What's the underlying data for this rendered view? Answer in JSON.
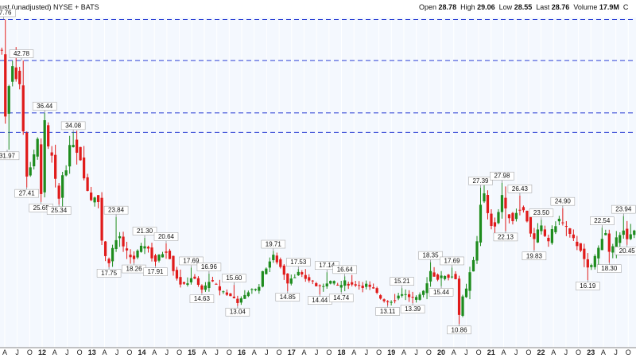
{
  "header": {
    "title": "ust (unadjusted)  NYSE + BATS",
    "ohlc": [
      {
        "label": "Open",
        "value": "28.78"
      },
      {
        "label": "High",
        "value": "29.06"
      },
      {
        "label": "Low",
        "value": "28.55"
      },
      {
        "label": "Last",
        "value": "28.76"
      },
      {
        "label": "Volume",
        "value": "17.9M"
      }
    ],
    "trailing": "C"
  },
  "colors": {
    "up": "#1e8c1e",
    "down": "#e01b1b",
    "resistance_line": "#2b3fd4",
    "plot_bg": "#f4f8fe",
    "grid": "#ffffff"
  },
  "chart_data": {
    "type": "candlestick",
    "x_axis_labels": [
      "A",
      "J",
      "O",
      "12",
      "A",
      "J",
      "O",
      "13",
      "A",
      "J",
      "O",
      "14",
      "A",
      "J",
      "O",
      "15",
      "A",
      "J",
      "O",
      "16",
      "A",
      "J",
      "O",
      "17",
      "A",
      "J",
      "O",
      "18",
      "A",
      "J",
      "O",
      "19",
      "A",
      "J",
      "O",
      "20",
      "A",
      "J",
      "O",
      "21",
      "A",
      "J",
      "O",
      "22",
      "A",
      "J",
      "O",
      "23",
      "A",
      "J",
      "O"
    ],
    "x_axis_label_years": [
      "12",
      "13",
      "14",
      "15",
      "16",
      "17",
      "18",
      "19",
      "20",
      "21",
      "22",
      "23"
    ],
    "ylim": [
      8,
      48
    ],
    "resistance_levels": [
      47.76,
      42.78,
      36.44,
      34.08
    ],
    "price_labels": [
      "47.76",
      "42.78",
      "31.97",
      "27.41",
      "36.44",
      "25.65",
      "25.34",
      "34.08",
      "23.84",
      "17.75",
      "18.26",
      "21.30",
      "17.91",
      "20.64",
      "17.69",
      "16.96",
      "14.63",
      "15.60",
      "13.04",
      "19.71",
      "14.85",
      "17.53",
      "14.44",
      "17.14",
      "14.74",
      "16.64",
      "15.21",
      "13.11",
      "13.39",
      "18.35",
      "15.44",
      "17.69",
      "10.86",
      "27.39",
      "27.98",
      "22.13",
      "26.43",
      "23.50",
      "19.83",
      "24.90",
      "16.19",
      "22.54",
      "18.30",
      "23.94",
      "20.45"
    ],
    "price_label_marks": [
      {
        "text": "47.76",
        "type": "high",
        "x": 0.5
      },
      {
        "text": "42.78",
        "type": "high",
        "x": 5.5
      },
      {
        "text": "31.97",
        "type": "low",
        "x": 1.5
      },
      {
        "text": "27.41",
        "type": "low",
        "x": 7.0
      },
      {
        "text": "36.44",
        "type": "high",
        "x": 12.0
      },
      {
        "text": "25.65",
        "type": "low",
        "x": 11.0
      },
      {
        "text": "25.34",
        "type": "low",
        "x": 16.0
      },
      {
        "text": "34.08",
        "type": "high",
        "x": 20.0
      },
      {
        "text": "23.84",
        "type": "high",
        "x": 32.0
      },
      {
        "text": "17.75",
        "type": "low",
        "x": 30.0
      },
      {
        "text": "18.26",
        "type": "low",
        "x": 37.0
      },
      {
        "text": "21.30",
        "type": "high",
        "x": 40.0
      },
      {
        "text": "17.91",
        "type": "low",
        "x": 43.0
      },
      {
        "text": "20.64",
        "type": "high",
        "x": 46.0
      },
      {
        "text": "17.69",
        "type": "high",
        "x": 53.0
      },
      {
        "text": "16.96",
        "type": "high",
        "x": 58.0
      },
      {
        "text": "14.63",
        "type": "low",
        "x": 56.0
      },
      {
        "text": "15.60",
        "type": "high",
        "x": 65.0
      },
      {
        "text": "13.04",
        "type": "low",
        "x": 66.0
      },
      {
        "text": "19.71",
        "type": "high",
        "x": 76.0
      },
      {
        "text": "14.85",
        "type": "low",
        "x": 80.0
      },
      {
        "text": "17.53",
        "type": "high",
        "x": 83.0
      },
      {
        "text": "14.44",
        "type": "low",
        "x": 89.0
      },
      {
        "text": "17.14",
        "type": "high",
        "x": 91.0
      },
      {
        "text": "14.74",
        "type": "low",
        "x": 95.0
      },
      {
        "text": "16.64",
        "type": "high",
        "x": 96.0
      },
      {
        "text": "15.21",
        "type": "high",
        "x": 112.0
      },
      {
        "text": "13.11",
        "type": "low",
        "x": 108.0
      },
      {
        "text": "13.39",
        "type": "low",
        "x": 115.0
      },
      {
        "text": "18.35",
        "type": "high",
        "x": 120.0
      },
      {
        "text": "15.44",
        "type": "low",
        "x": 123.0
      },
      {
        "text": "17.69",
        "type": "high",
        "x": 126.0
      },
      {
        "text": "10.86",
        "type": "low",
        "x": 128.0
      },
      {
        "text": "27.39",
        "type": "high",
        "x": 134.0
      },
      {
        "text": "27.98",
        "type": "high",
        "x": 140.0
      },
      {
        "text": "22.13",
        "type": "low",
        "x": 141.0
      },
      {
        "text": "26.43",
        "type": "high",
        "x": 145.0
      },
      {
        "text": "23.50",
        "type": "high",
        "x": 151.0
      },
      {
        "text": "19.83",
        "type": "low",
        "x": 149.0
      },
      {
        "text": "24.90",
        "type": "high",
        "x": 157.0
      },
      {
        "text": "16.19",
        "type": "low",
        "x": 164.0
      },
      {
        "text": "22.54",
        "type": "high",
        "x": 168.0
      },
      {
        "text": "18.30",
        "type": "low",
        "x": 170.0
      },
      {
        "text": "23.94",
        "type": "high",
        "x": 174.0
      },
      {
        "text": "20.45",
        "type": "low",
        "x": 175.0
      }
    ],
    "waypoints": [
      [
        0,
        44
      ],
      [
        1,
        36
      ],
      [
        2,
        40
      ],
      [
        3,
        42.5
      ],
      [
        4,
        41
      ],
      [
        5,
        40
      ],
      [
        6,
        34
      ],
      [
        7,
        29
      ],
      [
        8,
        30
      ],
      [
        9,
        31
      ],
      [
        10,
        33
      ],
      [
        11,
        27
      ],
      [
        12,
        35
      ],
      [
        13,
        32
      ],
      [
        14,
        31
      ],
      [
        15,
        28
      ],
      [
        16,
        26
      ],
      [
        17,
        29
      ],
      [
        18,
        30
      ],
      [
        19,
        32
      ],
      [
        20,
        33
      ],
      [
        21,
        32
      ],
      [
        22,
        31
      ],
      [
        23,
        29
      ],
      [
        24,
        27
      ],
      [
        25,
        26
      ],
      [
        26,
        26.5
      ],
      [
        27,
        26
      ],
      [
        28,
        21
      ],
      [
        29,
        19
      ],
      [
        30,
        18.5
      ],
      [
        31,
        20
      ],
      [
        32,
        21
      ],
      [
        33,
        21.5
      ],
      [
        34,
        20
      ],
      [
        35,
        19.5
      ],
      [
        36,
        19
      ],
      [
        37,
        18.8
      ],
      [
        38,
        19.5
      ],
      [
        39,
        20
      ],
      [
        40,
        20.5
      ],
      [
        41,
        20
      ],
      [
        42,
        19
      ],
      [
        43,
        18.5
      ],
      [
        44,
        19
      ],
      [
        45,
        19.5
      ],
      [
        46,
        19.8
      ],
      [
        47,
        19
      ],
      [
        48,
        17.5
      ],
      [
        49,
        16.5
      ],
      [
        50,
        15.8
      ],
      [
        51,
        15.5
      ],
      [
        52,
        16
      ],
      [
        53,
        16.5
      ],
      [
        54,
        16.2
      ],
      [
        55,
        15.5
      ],
      [
        56,
        15
      ],
      [
        57,
        15.4
      ],
      [
        58,
        16.2
      ],
      [
        59,
        15.8
      ],
      [
        60,
        15.5
      ],
      [
        61,
        15
      ],
      [
        62,
        14.8
      ],
      [
        63,
        14.5
      ],
      [
        64,
        14.2
      ],
      [
        65,
        14
      ],
      [
        66,
        13.6
      ],
      [
        67,
        13.8
      ],
      [
        68,
        14.2
      ],
      [
        69,
        14.8
      ],
      [
        70,
        15.2
      ],
      [
        71,
        15
      ],
      [
        72,
        15.6
      ],
      [
        73,
        17
      ],
      [
        74,
        17.8
      ],
      [
        75,
        18.5
      ],
      [
        76,
        19
      ],
      [
        77,
        18.5
      ],
      [
        78,
        17.8
      ],
      [
        79,
        17
      ],
      [
        80,
        16
      ],
      [
        81,
        16.5
      ],
      [
        82,
        16.8
      ],
      [
        83,
        17
      ],
      [
        84,
        16.6
      ],
      [
        85,
        16.4
      ],
      [
        86,
        16.2
      ],
      [
        87,
        16
      ],
      [
        88,
        15.5
      ],
      [
        89,
        15.3
      ],
      [
        90,
        15.6
      ],
      [
        91,
        16
      ],
      [
        92,
        16
      ],
      [
        93,
        15.8
      ],
      [
        94,
        15.5
      ],
      [
        95,
        15.6
      ],
      [
        96,
        15.9
      ],
      [
        97,
        15.8
      ],
      [
        98,
        15.6
      ],
      [
        99,
        15.7
      ],
      [
        100,
        15.6
      ],
      [
        101,
        15.5
      ],
      [
        102,
        15.6
      ],
      [
        103,
        15.2
      ],
      [
        104,
        15
      ],
      [
        105,
        14.5
      ],
      [
        106,
        14
      ],
      [
        107,
        13.8
      ],
      [
        108,
        13.6
      ],
      [
        109,
        13.7
      ],
      [
        110,
        13.9
      ],
      [
        111,
        14.3
      ],
      [
        112,
        14.6
      ],
      [
        113,
        14.4
      ],
      [
        114,
        14.2
      ],
      [
        115,
        14
      ],
      [
        116,
        13.9
      ],
      [
        117,
        14.2
      ],
      [
        118,
        14.8
      ],
      [
        119,
        16
      ],
      [
        120,
        17.3
      ],
      [
        121,
        16.8
      ],
      [
        122,
        16.4
      ],
      [
        123,
        16.5
      ],
      [
        124,
        16.8
      ],
      [
        125,
        16.6
      ],
      [
        126,
        16.7
      ],
      [
        127,
        16.5
      ],
      [
        128,
        12
      ],
      [
        129,
        14
      ],
      [
        130,
        15
      ],
      [
        131,
        17
      ],
      [
        132,
        18.5
      ],
      [
        133,
        21
      ],
      [
        134,
        25.5
      ],
      [
        135,
        26.5
      ],
      [
        136,
        24
      ],
      [
        137,
        23
      ],
      [
        138,
        23
      ],
      [
        139,
        24.5
      ],
      [
        140,
        26.5
      ],
      [
        141,
        24.5
      ],
      [
        142,
        24
      ],
      [
        143,
        23.5
      ],
      [
        144,
        24.5
      ],
      [
        145,
        25
      ],
      [
        146,
        24.5
      ],
      [
        147,
        23.5
      ],
      [
        148,
        22
      ],
      [
        149,
        21
      ],
      [
        150,
        22
      ],
      [
        151,
        22.5
      ],
      [
        152,
        21.5
      ],
      [
        153,
        21
      ],
      [
        154,
        22
      ],
      [
        155,
        23
      ],
      [
        156,
        23.5
      ],
      [
        157,
        23
      ],
      [
        158,
        22.5
      ],
      [
        159,
        21.5
      ],
      [
        160,
        21
      ],
      [
        161,
        20.5
      ],
      [
        162,
        20
      ],
      [
        163,
        18.5
      ],
      [
        164,
        17.5
      ],
      [
        165,
        18
      ],
      [
        166,
        19
      ],
      [
        167,
        20
      ],
      [
        168,
        21.5
      ],
      [
        169,
        22
      ],
      [
        170,
        19.5
      ],
      [
        171,
        20
      ],
      [
        172,
        21
      ],
      [
        173,
        22
      ],
      [
        174,
        22.5
      ],
      [
        175,
        21
      ],
      [
        176,
        21.5
      ],
      [
        177,
        22
      ]
    ]
  }
}
